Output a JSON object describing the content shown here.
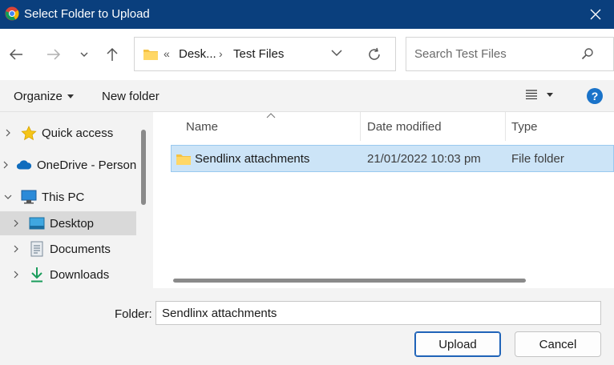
{
  "window": {
    "title": "Select Folder to Upload"
  },
  "address": {
    "segments": [
      "Desk...",
      "Test Files"
    ],
    "overflow": "«"
  },
  "search": {
    "placeholder": "Search Test Files"
  },
  "toolbar": {
    "organize_label": "Organize",
    "new_folder_label": "New folder"
  },
  "help": {
    "label": "?"
  },
  "nav": {
    "items": [
      {
        "label": "Quick access",
        "icon": "star-icon"
      },
      {
        "label": "OneDrive - Person",
        "icon": "cloud-icon"
      },
      {
        "label": "This PC",
        "icon": "computer-icon"
      },
      {
        "label": "Desktop",
        "icon": "desktop-icon",
        "selected": true
      },
      {
        "label": "Documents",
        "icon": "documents-icon"
      },
      {
        "label": "Downloads",
        "icon": "download-icon"
      }
    ]
  },
  "columns": {
    "name": "Name",
    "date": "Date modified",
    "type": "Type"
  },
  "files": [
    {
      "name": "Sendlinx attachments",
      "date": "21/01/2022 10:03 pm",
      "type": "File folder"
    }
  ],
  "footer": {
    "folder_label": "Folder:",
    "folder_value": "Sendlinx attachments",
    "upload_label": "Upload",
    "cancel_label": "Cancel"
  },
  "colors": {
    "titlebar": "#0a3f7d",
    "selection": "#cce4f7",
    "accent": "#1f63b8"
  }
}
